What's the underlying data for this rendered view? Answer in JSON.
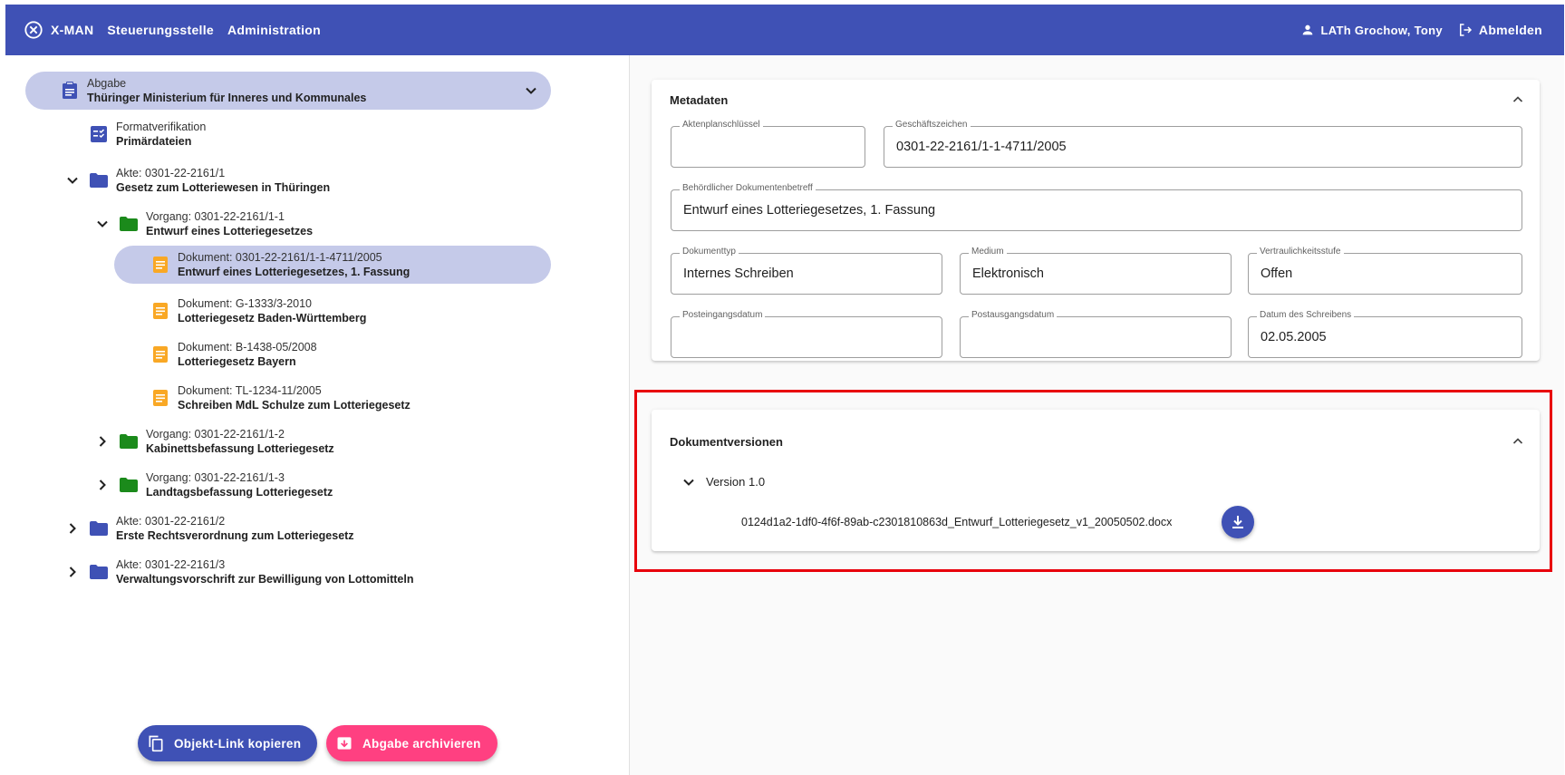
{
  "toolbar": {
    "app_name": "X-MAN",
    "nav": [
      "Steuerungsstelle",
      "Administration"
    ],
    "user": "LATh Grochow, Tony",
    "logout": "Abmelden"
  },
  "tree": {
    "root": {
      "label": "Abgabe",
      "title": "Thüringer Ministerium für Inneres und Kommunales"
    },
    "format": {
      "label": "Formatverifikation",
      "title": "Primärdateien"
    },
    "akte1": {
      "label": "Akte: 0301-22-2161/1",
      "title": "Gesetz zum Lotteriewesen in Thüringen"
    },
    "vorgang1": {
      "label": "Vorgang: 0301-22-2161/1-1",
      "title": "Entwurf eines Lotteriegesetzes"
    },
    "documents": [
      {
        "label": "Dokument: 0301-22-2161/1-1-4711/2005",
        "title": "Entwurf eines Lotteriegesetzes, 1. Fassung"
      },
      {
        "label": "Dokument: G-1333/3-2010",
        "title": "Lotteriegesetz Baden-Württemberg"
      },
      {
        "label": "Dokument: B-1438-05/2008",
        "title": "Lotteriegesetz Bayern"
      },
      {
        "label": "Dokument: TL-1234-11/2005",
        "title": "Schreiben MdL Schulze zum Lotteriegesetz"
      }
    ],
    "vorgang2": {
      "label": "Vorgang: 0301-22-2161/1-2",
      "title": "Kabinettsbefassung Lotteriegesetz"
    },
    "vorgang3": {
      "label": "Vorgang: 0301-22-2161/1-3",
      "title": "Landtagsbefassung Lotteriegesetz"
    },
    "akte2": {
      "label": "Akte: 0301-22-2161/2",
      "title": "Erste Rechtsverordnung zum Lotteriegesetz"
    },
    "akte3": {
      "label": "Akte: 0301-22-2161/3",
      "title": "Verwaltungsvorschrift zur Bewilligung von Lottomitteln"
    }
  },
  "actions": {
    "copy_link": "Objekt-Link kopieren",
    "archive": "Abgabe archivieren"
  },
  "metadata": {
    "title": "Metadaten",
    "fields": {
      "aktenplanschluessel": {
        "label": "Aktenplanschlüssel",
        "value": ""
      },
      "geschaeftszeichen": {
        "label": "Geschäftszeichen",
        "value": "0301-22-2161/1-1-4711/2005"
      },
      "betreff": {
        "label": "Behördlicher Dokumentenbetreff",
        "value": "Entwurf eines Lotteriegesetzes, 1. Fassung"
      },
      "dokumenttyp": {
        "label": "Dokumenttyp",
        "value": "Internes Schreiben"
      },
      "medium": {
        "label": "Medium",
        "value": "Elektronisch"
      },
      "vertraulichkeit": {
        "label": "Vertraulichkeitsstufe",
        "value": "Offen"
      },
      "posteingang": {
        "label": "Posteingangsdatum",
        "value": ""
      },
      "postausgang": {
        "label": "Postausgangsdatum",
        "value": ""
      },
      "datum_schreiben": {
        "label": "Datum des Schreibens",
        "value": "02.05.2005"
      }
    }
  },
  "versions": {
    "title": "Dokumentversionen",
    "version_label": "Version 1.0",
    "file_name": "0124d1a2-1df0-4f6f-89ab-c2301810863d_Entwurf_Lotteriegesetz_v1_20050502.docx"
  },
  "colors": {
    "primary": "#3f51b5",
    "selected": "#c5cae9",
    "accent": "#ff4081",
    "folder_blue": "#3f51b5",
    "folder_green": "#1b8a1b",
    "document": "#f9a825",
    "highlight": "#e8000b"
  }
}
